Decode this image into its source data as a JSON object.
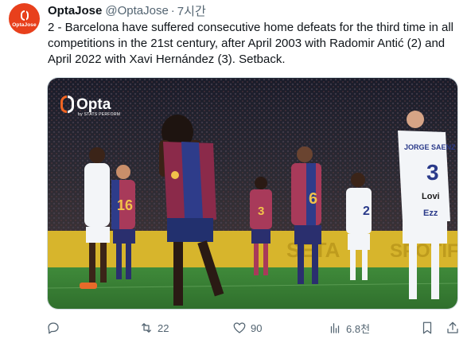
{
  "avatar": {
    "label": "OptaJose"
  },
  "author": {
    "name": "OptaJose",
    "handle": "@OptaJose",
    "separator": "·",
    "time": "7시간"
  },
  "tweet": {
    "text": "2 - Barcelona have suffered consecutive home defeats for the third time in all competitions in the 21st century, after April 2003 with Radomir Antić (2) and April 2022 with Xavi Hernández (3). Setback."
  },
  "media": {
    "logo": {
      "word": "Opta",
      "sub": "by STATS PERFORM"
    },
    "scene_text": {
      "player_left_number": "16",
      "player_mid_number": "3",
      "player_right_number": "6",
      "player_away_number": "2",
      "player_far_right_number": "3",
      "player_far_right_name": "JORGE SAENZ",
      "sponsor_1": "Lovi",
      "sponsor_2": "Ezz",
      "board_text": "SETA",
      "board_text_2": "SPOTIFY"
    }
  },
  "actions": {
    "reply": {
      "count": ""
    },
    "retweet": {
      "count": "22"
    },
    "like": {
      "count": "90"
    },
    "views": {
      "count": "6.8천"
    }
  },
  "colors": {
    "brand": "#e8401c",
    "muted": "#536471",
    "text": "#0f1419",
    "border": "#cfd9de"
  }
}
